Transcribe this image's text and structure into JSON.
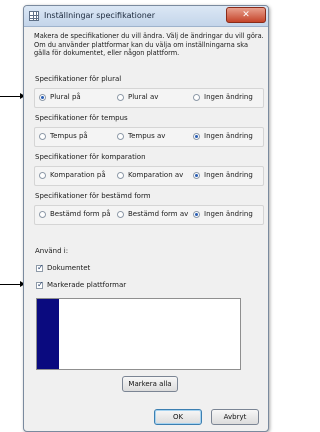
{
  "window": {
    "title": "Inställningar specifikationer",
    "close_glyph": "✕"
  },
  "intro": "Makera de specifikationer du vill ändra. Välj de ändringar du vill göra. Om du använder plattformar kan du välja om inställningarna ska gälla för dokumentet, eller någon plattform.",
  "groups": [
    {
      "label": "Specifikationer för plural",
      "options": [
        "Plural på",
        "Plural av",
        "Ingen ändring"
      ],
      "selected": 0
    },
    {
      "label": "Specifikationer för tempus",
      "options": [
        "Tempus på",
        "Tempus av",
        "Ingen ändring"
      ],
      "selected": 2
    },
    {
      "label": "Specifikationer för komparation",
      "options": [
        "Komparation på",
        "Komparation av",
        "Ingen ändring"
      ],
      "selected": 2
    },
    {
      "label": "Specifikationer för bestämd form",
      "options": [
        "Bestämd form på",
        "Bestämd form av",
        "Ingen ändring"
      ],
      "selected": 2
    }
  ],
  "apply_to": {
    "label": "Använd i:",
    "document_label": "Dokumentet",
    "document_checked": true,
    "platforms_label": "Markerade plattformar",
    "platforms_checked": true
  },
  "platform_list": {
    "swatch_color": "#0a0a7f"
  },
  "buttons": {
    "select_all": "Markera alla",
    "ok": "OK",
    "cancel": "Avbryt"
  }
}
